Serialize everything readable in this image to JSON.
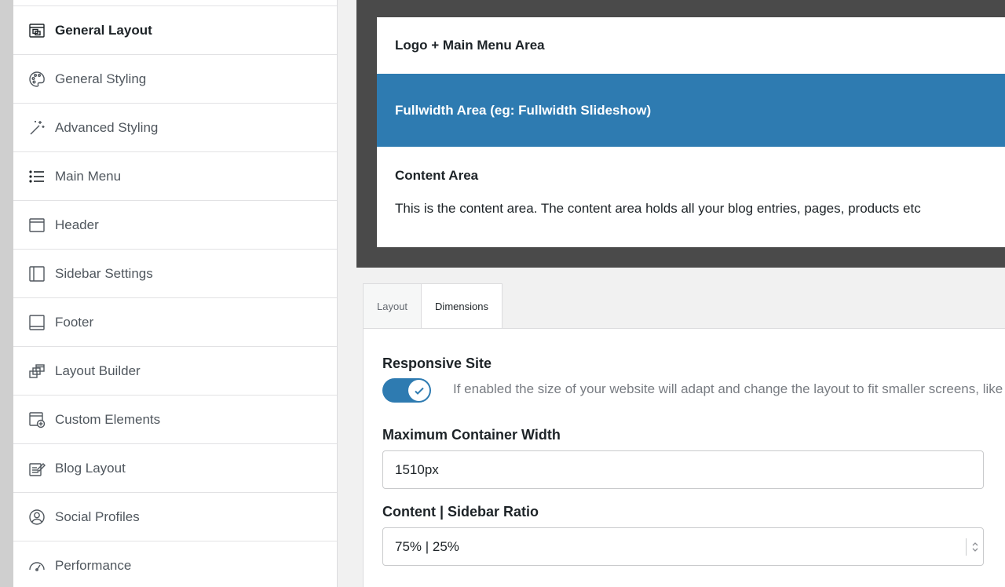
{
  "sidebar": {
    "items": [
      {
        "label": "General Layout",
        "icon": "layout-icon",
        "active": true
      },
      {
        "label": "General Styling",
        "icon": "palette-icon",
        "active": false
      },
      {
        "label": "Advanced Styling",
        "icon": "magic-wand-icon",
        "active": false
      },
      {
        "label": "Main Menu",
        "icon": "list-icon",
        "active": false
      },
      {
        "label": "Header",
        "icon": "header-icon",
        "active": false
      },
      {
        "label": "Sidebar Settings",
        "icon": "sidebar-icon",
        "active": false
      },
      {
        "label": "Footer",
        "icon": "footer-icon",
        "active": false
      },
      {
        "label": "Layout Builder",
        "icon": "layers-icon",
        "active": false
      },
      {
        "label": "Custom Elements",
        "icon": "custom-element-icon",
        "active": false
      },
      {
        "label": "Blog Layout",
        "icon": "blog-edit-icon",
        "active": false
      },
      {
        "label": "Social Profiles",
        "icon": "user-circle-icon",
        "active": false
      },
      {
        "label": "Performance",
        "icon": "gauge-icon",
        "active": false
      }
    ]
  },
  "preview": {
    "logo_area": "Logo + Main Menu Area",
    "fullwidth_area": "Fullwidth Area (eg: Fullwidth Slideshow)",
    "content_title": "Content Area",
    "content_text": "This is the content area. The content area holds all your blog entries, pages, products etc"
  },
  "tabs": [
    {
      "label": "Layout",
      "active": false
    },
    {
      "label": "Dimensions",
      "active": true
    }
  ],
  "settings": {
    "responsive_label": "Responsive Site",
    "responsive_enabled": true,
    "responsive_desc": "If enabled the size of your website will adapt and change the layout to fit smaller screens, like t",
    "max_width_label": "Maximum Container Width",
    "max_width_value": "1510px",
    "ratio_label": "Content | Sidebar Ratio",
    "ratio_value": "75% | 25%"
  },
  "colors": {
    "accent": "#2e7bb1",
    "preview_frame": "#4a4a4a"
  }
}
